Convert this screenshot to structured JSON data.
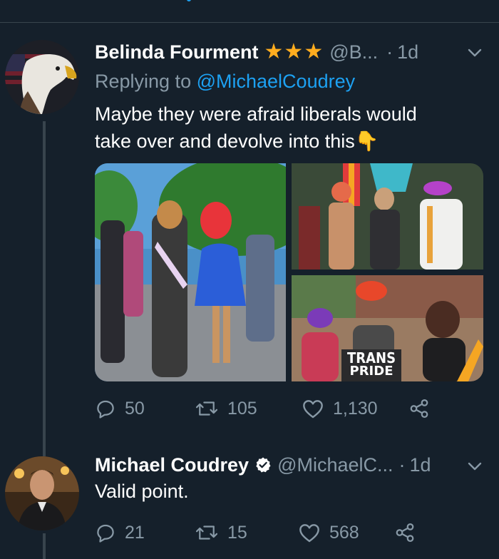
{
  "colors": {
    "background": "#15202b",
    "divider": "#38444d",
    "accent": "#1da1f2",
    "secondary_text": "#8899a6",
    "star": "#ffad1f"
  },
  "tweet1": {
    "name": "Belinda Fourment",
    "name_badges": [
      "star-icon",
      "star-icon",
      "star-icon"
    ],
    "handle": "@B...",
    "separator": "·",
    "time": "1d",
    "reply_prefix": "Replying to",
    "reply_to": "@MichaelCoudrey",
    "text_line1": "Maybe they were afraid liberals would",
    "text_line2": "take over and devolve into this",
    "emoji": "👇",
    "media_sign_text": "TRANS",
    "media_sign_text2": "PRIDE",
    "stats": {
      "replies": "50",
      "retweets": "105",
      "likes": "1,130"
    }
  },
  "tweet2": {
    "name": "Michael Coudrey",
    "handle": "@MichaelC...",
    "separator": "·",
    "time": "1d",
    "text": "Valid point.",
    "stats": {
      "replies": "21",
      "retweets": "15",
      "likes": "568"
    }
  }
}
